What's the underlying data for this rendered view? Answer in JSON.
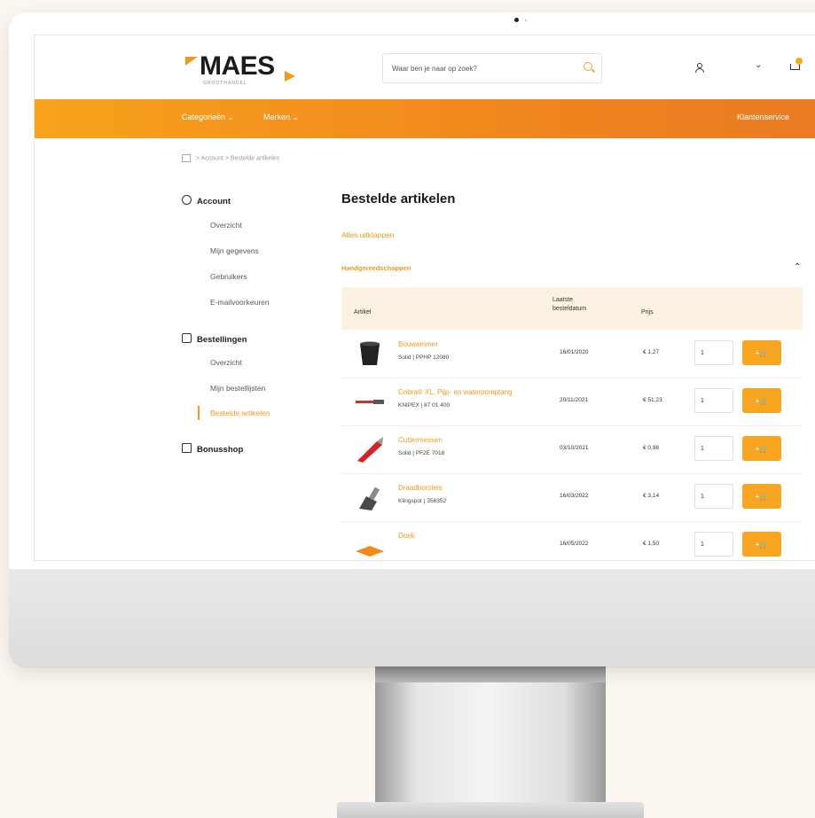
{
  "header": {
    "logo_text": "MAES",
    "logo_subtext": "GROOTHANDEL",
    "search_placeholder": "Waar ben je naar op zoek?"
  },
  "nav": {
    "categories": "Categorieën ⌄",
    "brands": "Merken ⌄",
    "service": "Klantenservice"
  },
  "breadcrumb": {
    "items": [
      "Account",
      "Bestelde artikelen"
    ],
    "separator": ">"
  },
  "sidebar": {
    "account": "Account",
    "account_links": [
      "Overzicht",
      "Mijn gegevens",
      "Gebruikers",
      "E-mailvoorkeuren"
    ],
    "orders": "Bestellingen",
    "order_links": [
      "Overzicht",
      "Mijn bestellijsten",
      "Bestelde artikelen"
    ],
    "bonusshop": "Bonusshop"
  },
  "main": {
    "title": "Bestelde artikelen",
    "collapse_all": "Alles uitklappen",
    "group_title": "Handgereedschappen",
    "columns": {
      "artikel": "Artikel",
      "datum": "Laatste besteldatum",
      "prijs": "Prijs"
    },
    "rows": [
      {
        "name": "Bouwemmer",
        "sku": "Solid | PPHP 12080",
        "date": "16/01/2020",
        "price": "€ 1,27",
        "qty": "1",
        "add": "+🛒"
      },
      {
        "name": "Cobra® XL, Pijp- en waterpomptang",
        "sku": "KNIPEX | 87 01 400",
        "date": "20/11/2021",
        "price": "€ 51,23",
        "qty": "1",
        "add": "+🛒"
      },
      {
        "name": "Cuttermessen",
        "sku": "Solid | PF2E 7018",
        "date": "03/10/2021",
        "price": "€ 0,98",
        "qty": "1",
        "add": "+🛒"
      },
      {
        "name": "Draadborstels",
        "sku": "Klingspor | 356352",
        "date": "16/03/2022",
        "price": "€ 3,14",
        "qty": "1",
        "add": "+🛒"
      },
      {
        "name": "Doek",
        "sku": "",
        "date": "16/05/2022",
        "price": "€ 1,50",
        "qty": "1",
        "add": "+🛒"
      }
    ]
  },
  "colors": {
    "accent": "#f39a1e",
    "nav_start": "#f8a21c",
    "nav_end": "#ea7a24",
    "table_header_bg": "#fdf2e2"
  }
}
